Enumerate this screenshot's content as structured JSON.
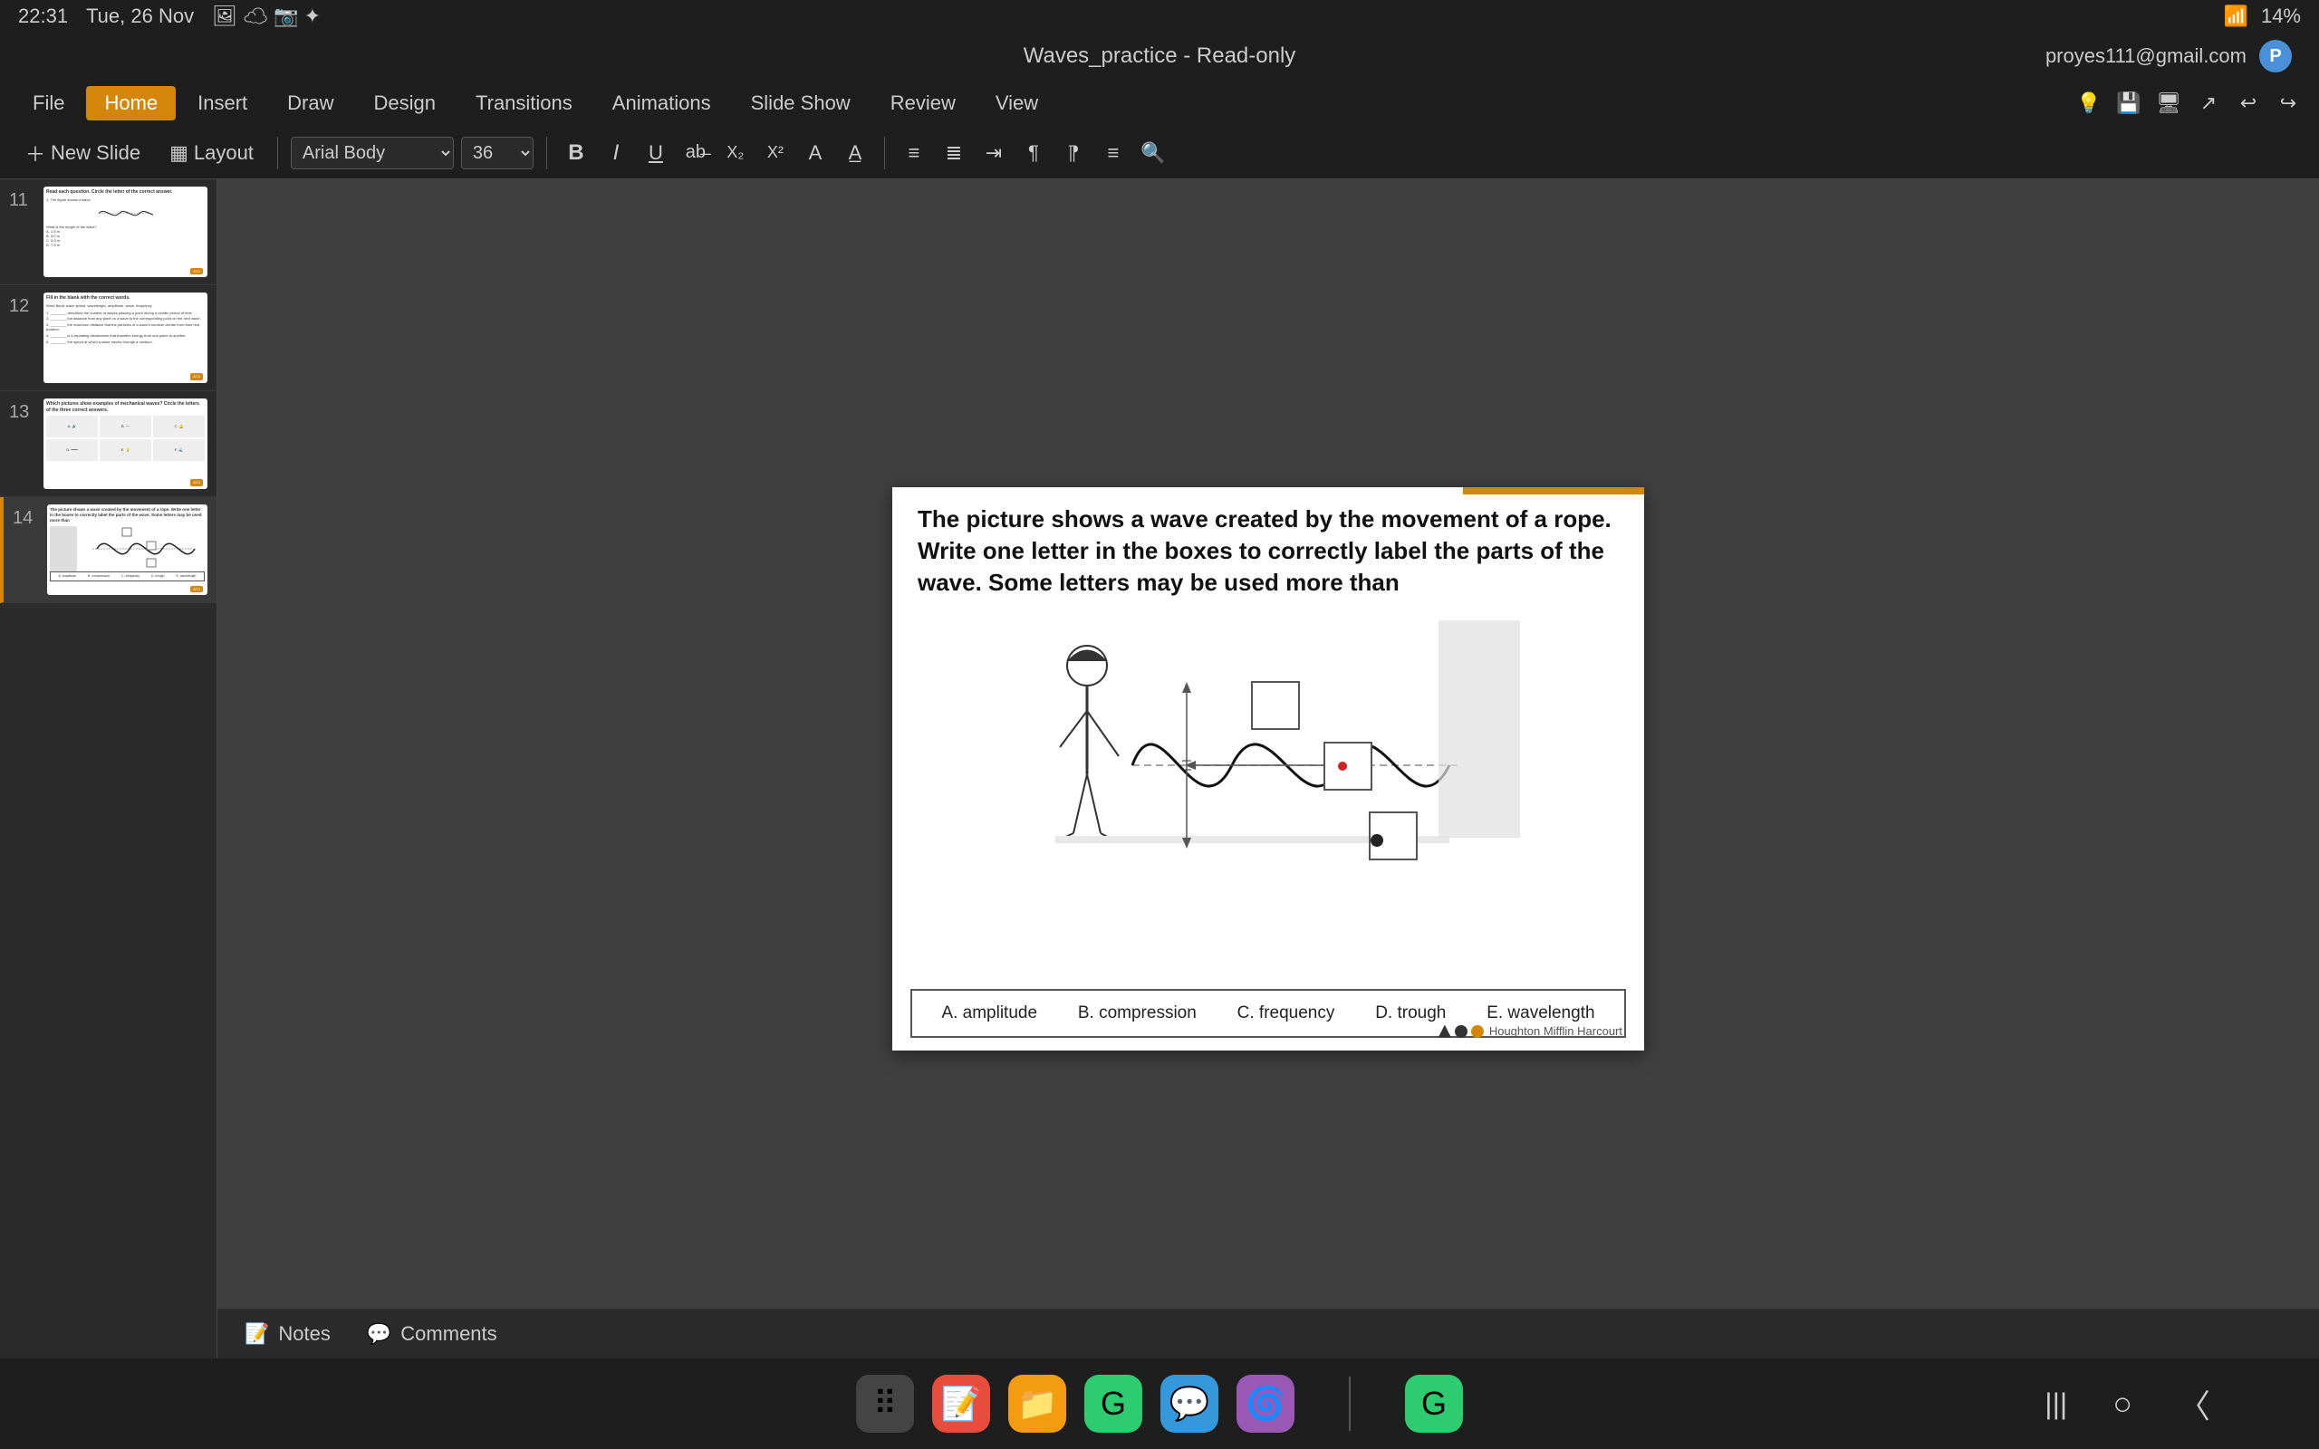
{
  "statusBar": {
    "time": "22:31",
    "date": "Tue, 26 Nov",
    "batteryPercent": "14%"
  },
  "titleBar": {
    "title": "Waves_practice - Read-only",
    "user": "proyes111@gmail.com",
    "userInitial": "P"
  },
  "menuBar": {
    "items": [
      "File",
      "Home",
      "Insert",
      "Draw",
      "Design",
      "Transitions",
      "Animations",
      "Slide Show",
      "Review",
      "View"
    ],
    "active": "Home"
  },
  "toolbar": {
    "newSlide": "New Slide",
    "layout": "Layout",
    "fontName": "Arial Body",
    "fontSize": "36",
    "bold": "B",
    "italic": "I",
    "underline": "U"
  },
  "slides": [
    {
      "num": "11",
      "previewText": "Read each question. Circle the letter of the correct answer.",
      "active": false
    },
    {
      "num": "12",
      "previewText": "Fill in the blank with the correct words.",
      "active": false
    },
    {
      "num": "13",
      "previewText": "Which pictures show examples of mechanical waves? Circle the letters of the three correct answers.",
      "active": false
    },
    {
      "num": "14",
      "previewText": "The picture shows a wave created by the movement of a rope.",
      "active": true
    }
  ],
  "currentSlide": {
    "title": "The picture shows a wave created by the movement of a rope. Write one letter in the boxes to correctly label the parts of the wave. Some letters may be used more than",
    "answerOptions": [
      "A. amplitude",
      "B. compression",
      "C. frequency",
      "D. trough",
      "E. wavelength"
    ]
  },
  "notesBar": {
    "notesLabel": "Notes",
    "commentsLabel": "Comments"
  },
  "bottomBar": {
    "apps": [
      "⠿",
      "🟥",
      "📁",
      "G",
      "💬",
      "🌀"
    ],
    "navIcons": [
      "|||",
      "○",
      "〈"
    ]
  },
  "footer": {
    "brand": "Houghton Mifflin Harcourt"
  }
}
